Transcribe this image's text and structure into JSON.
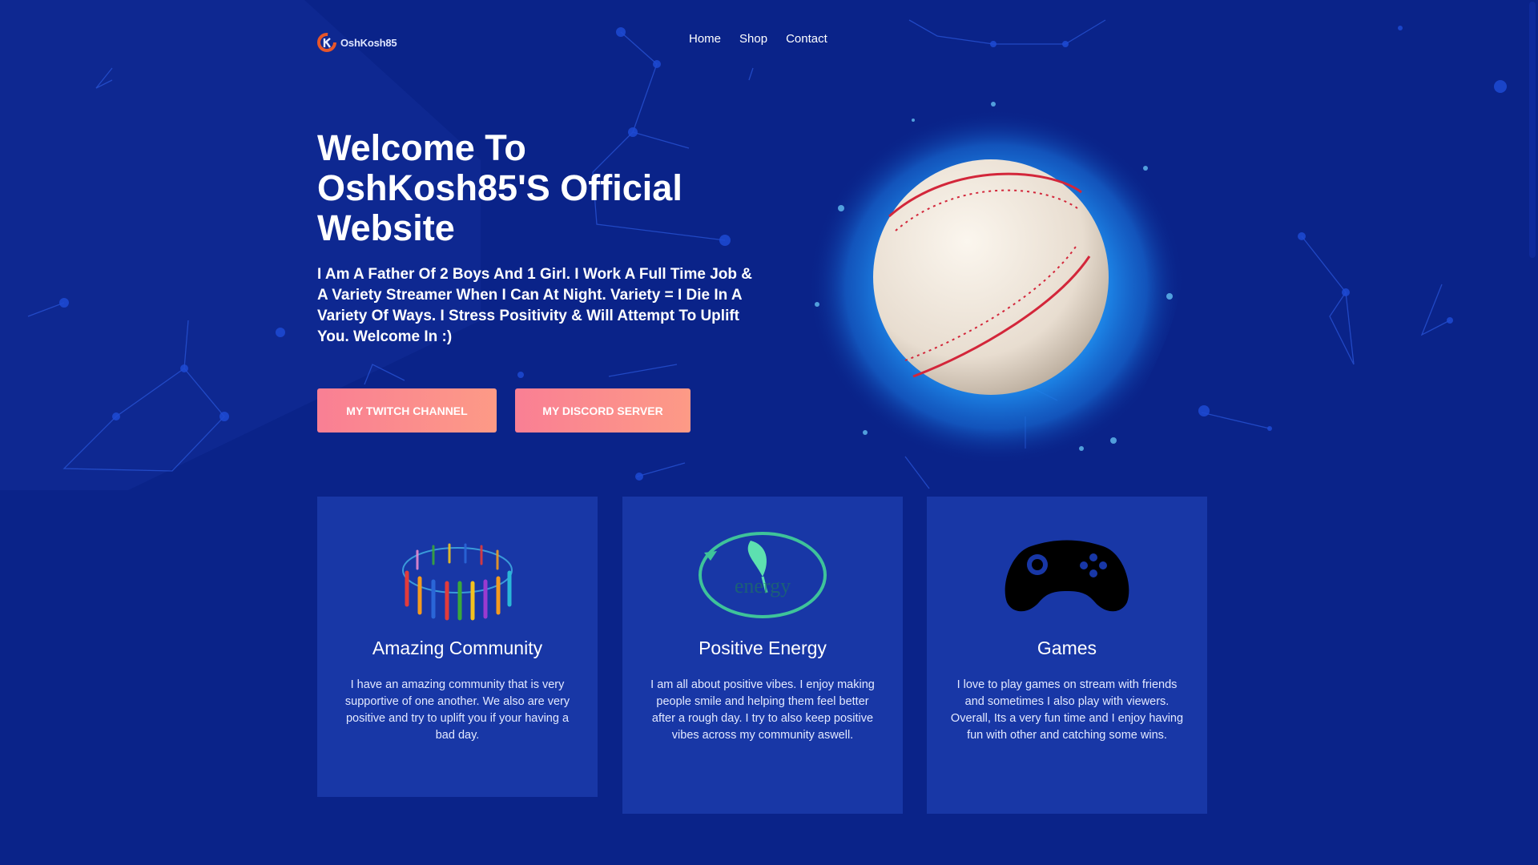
{
  "brand": {
    "name": "OshKosh85"
  },
  "nav": {
    "items": [
      "Home",
      "Shop",
      "Contact"
    ]
  },
  "hero": {
    "title": "Welcome To OshKosh85'S Official Website",
    "description": "I Am A Father Of 2 Boys And 1 Girl. I Work A Full Time Job & A Variety Streamer When I Can At Night. Variety = I Die In A Variety Of Ways. I Stress Positivity & Will Attempt To Uplift You. Welcome In :)",
    "buttons": {
      "twitch": "MY TWITCH CHANNEL",
      "discord": "MY DISCORD SERVER"
    }
  },
  "features": [
    {
      "icon": "community-circle-icon",
      "title": "Amazing Community",
      "text": "I have an amazing community that is very supportive of one another. We also are very positive and try to uplift you if your having a bad day."
    },
    {
      "icon": "positive-energy-leaf-icon",
      "title": "Positive Energy",
      "text": "I am all about positive vibes. I enjoy making people smile and helping them feel better after a rough day. I try to also keep positive vibes across my community aswell."
    },
    {
      "icon": "gamepad-icon",
      "title": "Games",
      "text": "I love to play games on stream with friends and sometimes I also play with viewers. Overall, Its a very fun time and I enjoy having fun with other and catching some wins."
    }
  ],
  "colors": {
    "background": "#0a2389",
    "card": "#1837a6",
    "button_start": "#f97f94",
    "button_end": "#fd9a86"
  }
}
